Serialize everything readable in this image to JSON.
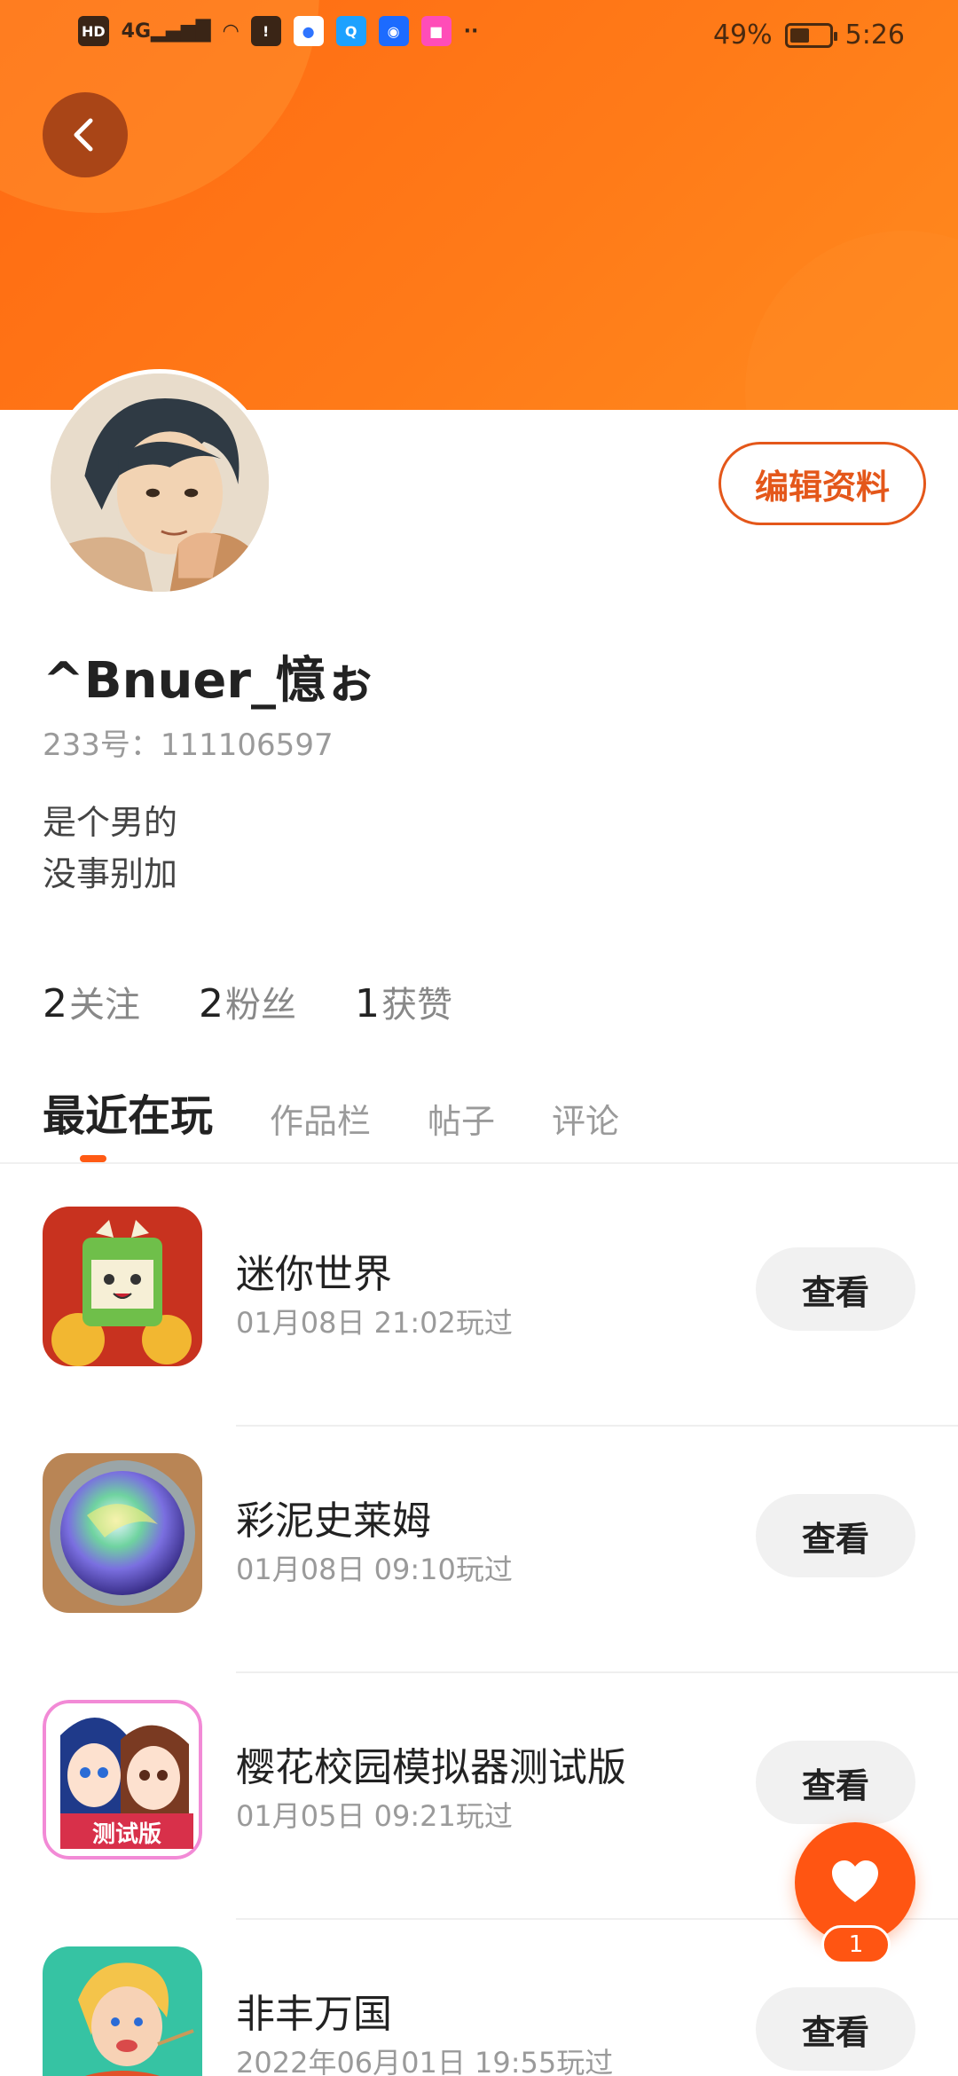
{
  "status_bar": {
    "hd": "HD",
    "network": "4G",
    "battery_percent": "49%",
    "time": "5:26",
    "battery_level": 0.49
  },
  "profile": {
    "edit_label": "编辑资料",
    "username": "^Bnuer_憶ぉ",
    "id_line": "233号：111106597",
    "bio": [
      "是个男的",
      "没事别加"
    ]
  },
  "stats": [
    {
      "value": "2",
      "label": "关注"
    },
    {
      "value": "2",
      "label": "粉丝"
    },
    {
      "value": "1",
      "label": "获赞"
    }
  ],
  "tabs": [
    {
      "label": "最近在玩",
      "active": true
    },
    {
      "label": "作品栏",
      "active": false
    },
    {
      "label": "帖子",
      "active": false
    },
    {
      "label": "评论",
      "active": false
    }
  ],
  "games": [
    {
      "name": "迷你世界",
      "time": "01月08日 21:02玩过",
      "button": "查看",
      "icon": "mini-world-icon"
    },
    {
      "name": "彩泥史莱姆",
      "time": "01月08日 09:10玩过",
      "button": "查看",
      "icon": "slime-icon"
    },
    {
      "name": "樱花校园模拟器测试版",
      "time": "01月05日 09:21玩过",
      "button": "查看",
      "icon": "sakura-school-icon",
      "icon_label": "测试版"
    },
    {
      "name": "非丰万国",
      "time": "2022年06月01日 19:55玩过",
      "button": "查看",
      "icon": "cooking-game-icon"
    }
  ],
  "fab": {
    "badge": "1",
    "icon": "heart-icon"
  },
  "colors": {
    "accent": "#ff5a14",
    "header": "#ff7a18",
    "edit_border": "#e4571a"
  }
}
